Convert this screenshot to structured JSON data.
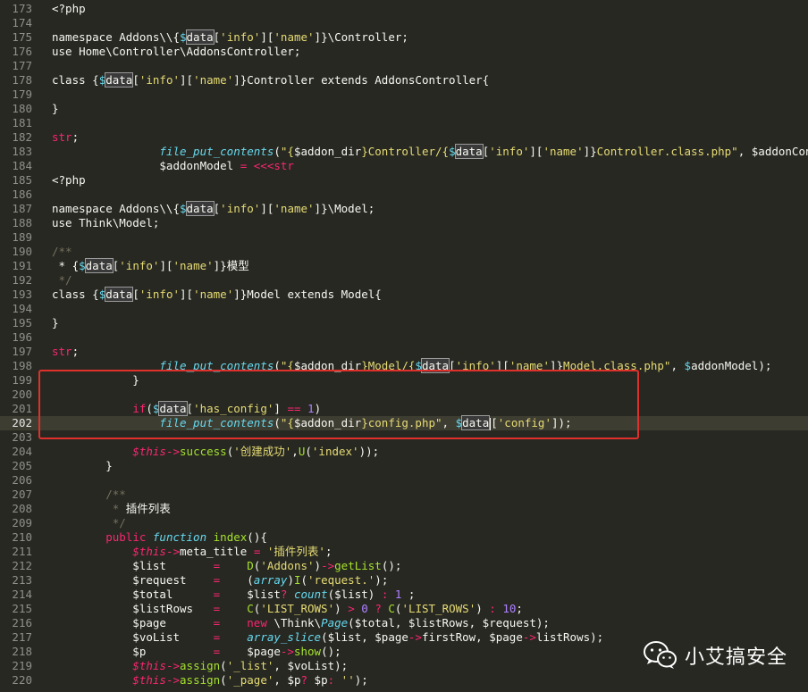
{
  "lines": [
    {
      "n": "173",
      "tokens": [
        {
          "c": "t-p",
          "t": "<?php"
        }
      ]
    },
    {
      "n": "174",
      "tokens": []
    },
    {
      "n": "175",
      "tokens": [
        {
          "c": "t-p",
          "t": "namespace Addons\\\\{"
        },
        {
          "c": "t-v",
          "t": "$"
        },
        {
          "c": "t-p",
          "t": "data",
          "box": true
        },
        {
          "c": "t-p",
          "t": "["
        },
        {
          "c": "t-s",
          "t": "'info'"
        },
        {
          "c": "t-p",
          "t": "]["
        },
        {
          "c": "t-s",
          "t": "'name'"
        },
        {
          "c": "t-p",
          "t": "]}\\Controller;"
        }
      ]
    },
    {
      "n": "176",
      "tokens": [
        {
          "c": "t-p",
          "t": "use Home\\Controller\\AddonsController;"
        }
      ]
    },
    {
      "n": "177",
      "tokens": []
    },
    {
      "n": "178",
      "tokens": [
        {
          "c": "t-p",
          "t": "class {"
        },
        {
          "c": "t-v",
          "t": "$"
        },
        {
          "c": "t-p",
          "t": "data",
          "box": true
        },
        {
          "c": "t-p",
          "t": "["
        },
        {
          "c": "t-s",
          "t": "'info'"
        },
        {
          "c": "t-p",
          "t": "]["
        },
        {
          "c": "t-s",
          "t": "'name'"
        },
        {
          "c": "t-p",
          "t": "]}Controller extends AddonsController{"
        }
      ]
    },
    {
      "n": "179",
      "tokens": []
    },
    {
      "n": "180",
      "tokens": [
        {
          "c": "t-p",
          "t": "}"
        }
      ]
    },
    {
      "n": "181",
      "tokens": []
    },
    {
      "n": "182",
      "tokens": [
        {
          "c": "t-k",
          "t": "str"
        },
        {
          "c": "t-p",
          "t": ";"
        }
      ]
    },
    {
      "n": "183",
      "tokens": [
        {
          "c": "t-p",
          "t": "                "
        },
        {
          "c": "t-fi",
          "t": "file_put_contents"
        },
        {
          "c": "t-p",
          "t": "("
        },
        {
          "c": "t-s",
          "t": "\"{"
        },
        {
          "c": "t-p",
          "t": "$addon_dir"
        },
        {
          "c": "t-s",
          "t": "}Controller/{"
        },
        {
          "c": "t-v",
          "t": "$"
        },
        {
          "c": "t-p",
          "t": "data",
          "box": true
        },
        {
          "c": "t-p",
          "t": "["
        },
        {
          "c": "t-s",
          "t": "'info'"
        },
        {
          "c": "t-p",
          "t": "]["
        },
        {
          "c": "t-s",
          "t": "'name'"
        },
        {
          "c": "t-p",
          "t": "]}"
        },
        {
          "c": "t-s",
          "t": "Controller.class.php\""
        },
        {
          "c": "t-p",
          "t": ", $addonControl"
        }
      ]
    },
    {
      "n": "184",
      "tokens": [
        {
          "c": "t-p",
          "t": "                $addonModel "
        },
        {
          "c": "t-k",
          "t": "="
        },
        {
          "c": "t-p",
          "t": " "
        },
        {
          "c": "t-k",
          "t": "<<<str"
        }
      ]
    },
    {
      "n": "185",
      "tokens": [
        {
          "c": "t-p",
          "t": "<?php"
        }
      ]
    },
    {
      "n": "186",
      "tokens": []
    },
    {
      "n": "187",
      "tokens": [
        {
          "c": "t-p",
          "t": "namespace Addons\\\\{"
        },
        {
          "c": "t-v",
          "t": "$"
        },
        {
          "c": "t-p",
          "t": "data",
          "box": true
        },
        {
          "c": "t-p",
          "t": "["
        },
        {
          "c": "t-s",
          "t": "'info'"
        },
        {
          "c": "t-p",
          "t": "]["
        },
        {
          "c": "t-s",
          "t": "'name'"
        },
        {
          "c": "t-p",
          "t": "]}\\Model;"
        }
      ]
    },
    {
      "n": "188",
      "tokens": [
        {
          "c": "t-p",
          "t": "use Think\\Model;"
        }
      ]
    },
    {
      "n": "189",
      "tokens": []
    },
    {
      "n": "190",
      "tokens": [
        {
          "c": "t-c",
          "t": "/**"
        }
      ]
    },
    {
      "n": "191",
      "tokens": [
        {
          "c": "t-p",
          "t": " * {"
        },
        {
          "c": "t-v",
          "t": "$"
        },
        {
          "c": "t-p",
          "t": "data",
          "box": true
        },
        {
          "c": "t-p",
          "t": "["
        },
        {
          "c": "t-s",
          "t": "'info'"
        },
        {
          "c": "t-p",
          "t": "]["
        },
        {
          "c": "t-s",
          "t": "'name'"
        },
        {
          "c": "t-p",
          "t": "]}模型"
        }
      ]
    },
    {
      "n": "192",
      "tokens": [
        {
          "c": "t-c",
          "t": " */"
        }
      ]
    },
    {
      "n": "193",
      "tokens": [
        {
          "c": "t-p",
          "t": "class {"
        },
        {
          "c": "t-v",
          "t": "$"
        },
        {
          "c": "t-p",
          "t": "data",
          "box": true
        },
        {
          "c": "t-p",
          "t": "["
        },
        {
          "c": "t-s",
          "t": "'info'"
        },
        {
          "c": "t-p",
          "t": "]["
        },
        {
          "c": "t-s",
          "t": "'name'"
        },
        {
          "c": "t-p",
          "t": "]}Model extends Model{"
        }
      ]
    },
    {
      "n": "194",
      "tokens": []
    },
    {
      "n": "195",
      "tokens": [
        {
          "c": "t-p",
          "t": "}"
        }
      ]
    },
    {
      "n": "196",
      "tokens": []
    },
    {
      "n": "197",
      "tokens": [
        {
          "c": "t-k",
          "t": "str"
        },
        {
          "c": "t-p",
          "t": ";"
        }
      ]
    },
    {
      "n": "198",
      "tokens": [
        {
          "c": "t-p",
          "t": "                "
        },
        {
          "c": "t-fi",
          "t": "file_put_contents"
        },
        {
          "c": "t-p",
          "t": "("
        },
        {
          "c": "t-s",
          "t": "\"{"
        },
        {
          "c": "t-p",
          "t": "$addon_dir"
        },
        {
          "c": "t-s",
          "t": "}Model/{"
        },
        {
          "c": "t-v",
          "t": "$"
        },
        {
          "c": "t-p",
          "t": "data",
          "box": true
        },
        {
          "c": "t-p",
          "t": "["
        },
        {
          "c": "t-s",
          "t": "'info'"
        },
        {
          "c": "t-p",
          "t": "]["
        },
        {
          "c": "t-s",
          "t": "'name'"
        },
        {
          "c": "t-p",
          "t": "]}"
        },
        {
          "c": "t-s",
          "t": "Model.class.php\""
        },
        {
          "c": "t-p",
          "t": ", "
        },
        {
          "c": "t-v",
          "t": "$"
        },
        {
          "c": "t-p",
          "t": "addonModel);"
        }
      ]
    },
    {
      "n": "199",
      "tokens": [
        {
          "c": "t-p",
          "t": "            }"
        }
      ]
    },
    {
      "n": "200",
      "tokens": []
    },
    {
      "n": "201",
      "tokens": [
        {
          "c": "t-p",
          "t": "            "
        },
        {
          "c": "t-k",
          "t": "if"
        },
        {
          "c": "t-p",
          "t": "("
        },
        {
          "c": "t-v",
          "t": "$"
        },
        {
          "c": "t-p",
          "t": "data",
          "box": true
        },
        {
          "c": "t-p",
          "t": "["
        },
        {
          "c": "t-s",
          "t": "'has_config'"
        },
        {
          "c": "t-p",
          "t": "] "
        },
        {
          "c": "t-k",
          "t": "=="
        },
        {
          "c": "t-p",
          "t": " "
        },
        {
          "c": "t-n",
          "t": "1"
        },
        {
          "c": "t-p",
          "t": ")"
        }
      ]
    },
    {
      "n": "202",
      "current": true,
      "tokens": [
        {
          "c": "t-p",
          "t": "                "
        },
        {
          "c": "t-fi",
          "t": "file_put_contents"
        },
        {
          "c": "t-p",
          "t": "("
        },
        {
          "c": "t-s",
          "t": "\"{"
        },
        {
          "c": "t-p",
          "t": "$addon_dir"
        },
        {
          "c": "t-s",
          "t": "}config.php\""
        },
        {
          "c": "t-p",
          "t": ", "
        },
        {
          "c": "t-v",
          "t": "$"
        },
        {
          "c": "t-p",
          "t": "data",
          "box": true,
          "cursor": true
        },
        {
          "c": "t-p",
          "t": "["
        },
        {
          "c": "t-s",
          "t": "'config'"
        },
        {
          "c": "t-p",
          "t": "]);"
        }
      ]
    },
    {
      "n": "203",
      "tokens": []
    },
    {
      "n": "204",
      "tokens": [
        {
          "c": "t-p",
          "t": "            "
        },
        {
          "c": "t-ti",
          "t": "$this"
        },
        {
          "c": "t-k",
          "t": "->"
        },
        {
          "c": "t-f",
          "t": "success"
        },
        {
          "c": "t-p",
          "t": "("
        },
        {
          "c": "t-s",
          "t": "'创建成功'"
        },
        {
          "c": "t-p",
          "t": ","
        },
        {
          "c": "t-f",
          "t": "U"
        },
        {
          "c": "t-p",
          "t": "("
        },
        {
          "c": "t-s",
          "t": "'index'"
        },
        {
          "c": "t-p",
          "t": "));"
        }
      ]
    },
    {
      "n": "205",
      "tokens": [
        {
          "c": "t-p",
          "t": "        }"
        }
      ]
    },
    {
      "n": "206",
      "tokens": []
    },
    {
      "n": "207",
      "tokens": [
        {
          "c": "t-c",
          "t": "        /**"
        }
      ]
    },
    {
      "n": "208",
      "tokens": [
        {
          "c": "t-c",
          "t": "         * "
        },
        {
          "c": "t-p",
          "t": "插件列表"
        }
      ]
    },
    {
      "n": "209",
      "tokens": [
        {
          "c": "t-c",
          "t": "         */"
        }
      ]
    },
    {
      "n": "210",
      "tokens": [
        {
          "c": "t-p",
          "t": "        "
        },
        {
          "c": "t-k",
          "t": "public"
        },
        {
          "c": "t-p",
          "t": " "
        },
        {
          "c": "t-fi",
          "t": "function"
        },
        {
          "c": "t-p",
          "t": " "
        },
        {
          "c": "t-f",
          "t": "index"
        },
        {
          "c": "t-p",
          "t": "(){"
        }
      ]
    },
    {
      "n": "211",
      "tokens": [
        {
          "c": "t-p",
          "t": "            "
        },
        {
          "c": "t-ti",
          "t": "$this"
        },
        {
          "c": "t-k",
          "t": "->"
        },
        {
          "c": "t-p",
          "t": "meta_title "
        },
        {
          "c": "t-k",
          "t": "="
        },
        {
          "c": "t-p",
          "t": " "
        },
        {
          "c": "t-s",
          "t": "'插件列表'"
        },
        {
          "c": "t-p",
          "t": ";"
        }
      ]
    },
    {
      "n": "212",
      "tokens": [
        {
          "c": "t-p",
          "t": "            $list       "
        },
        {
          "c": "t-k",
          "t": "="
        },
        {
          "c": "t-p",
          "t": "    "
        },
        {
          "c": "t-f",
          "t": "D"
        },
        {
          "c": "t-p",
          "t": "("
        },
        {
          "c": "t-s",
          "t": "'Addons'"
        },
        {
          "c": "t-p",
          "t": ")"
        },
        {
          "c": "t-k",
          "t": "->"
        },
        {
          "c": "t-f",
          "t": "getList"
        },
        {
          "c": "t-p",
          "t": "();"
        }
      ]
    },
    {
      "n": "213",
      "tokens": [
        {
          "c": "t-p",
          "t": "            $request    "
        },
        {
          "c": "t-k",
          "t": "="
        },
        {
          "c": "t-p",
          "t": "    ("
        },
        {
          "c": "t-fi",
          "t": "array"
        },
        {
          "c": "t-p",
          "t": ")"
        },
        {
          "c": "t-f",
          "t": "I"
        },
        {
          "c": "t-p",
          "t": "("
        },
        {
          "c": "t-s",
          "t": "'request.'"
        },
        {
          "c": "t-p",
          "t": ");"
        }
      ]
    },
    {
      "n": "214",
      "tokens": [
        {
          "c": "t-p",
          "t": "            $total      "
        },
        {
          "c": "t-k",
          "t": "="
        },
        {
          "c": "t-p",
          "t": "    $list"
        },
        {
          "c": "t-k",
          "t": "?"
        },
        {
          "c": "t-p",
          "t": " "
        },
        {
          "c": "t-fi",
          "t": "count"
        },
        {
          "c": "t-p",
          "t": "($list) "
        },
        {
          "c": "t-k",
          "t": ":"
        },
        {
          "c": "t-p",
          "t": " "
        },
        {
          "c": "t-n",
          "t": "1"
        },
        {
          "c": "t-p",
          "t": " ;"
        }
      ]
    },
    {
      "n": "215",
      "tokens": [
        {
          "c": "t-p",
          "t": "            $listRows   "
        },
        {
          "c": "t-k",
          "t": "="
        },
        {
          "c": "t-p",
          "t": "    "
        },
        {
          "c": "t-f",
          "t": "C"
        },
        {
          "c": "t-p",
          "t": "("
        },
        {
          "c": "t-s",
          "t": "'LIST_ROWS'"
        },
        {
          "c": "t-p",
          "t": ") "
        },
        {
          "c": "t-k",
          "t": ">"
        },
        {
          "c": "t-p",
          "t": " "
        },
        {
          "c": "t-n",
          "t": "0"
        },
        {
          "c": "t-p",
          "t": " "
        },
        {
          "c": "t-k",
          "t": "?"
        },
        {
          "c": "t-p",
          "t": " "
        },
        {
          "c": "t-f",
          "t": "C"
        },
        {
          "c": "t-p",
          "t": "("
        },
        {
          "c": "t-s",
          "t": "'LIST_ROWS'"
        },
        {
          "c": "t-p",
          "t": ") "
        },
        {
          "c": "t-k",
          "t": ":"
        },
        {
          "c": "t-p",
          "t": " "
        },
        {
          "c": "t-n",
          "t": "10"
        },
        {
          "c": "t-p",
          "t": ";"
        }
      ]
    },
    {
      "n": "216",
      "tokens": [
        {
          "c": "t-p",
          "t": "            $page       "
        },
        {
          "c": "t-k",
          "t": "="
        },
        {
          "c": "t-p",
          "t": "    "
        },
        {
          "c": "t-k",
          "t": "new"
        },
        {
          "c": "t-p",
          "t": " \\Think\\"
        },
        {
          "c": "t-fi",
          "t": "Page"
        },
        {
          "c": "t-p",
          "t": "($total, $listRows, $request);"
        }
      ]
    },
    {
      "n": "217",
      "tokens": [
        {
          "c": "t-p",
          "t": "            $voList     "
        },
        {
          "c": "t-k",
          "t": "="
        },
        {
          "c": "t-p",
          "t": "    "
        },
        {
          "c": "t-fi",
          "t": "array_slice"
        },
        {
          "c": "t-p",
          "t": "($list, $page"
        },
        {
          "c": "t-k",
          "t": "->"
        },
        {
          "c": "t-p",
          "t": "firstRow, $page"
        },
        {
          "c": "t-k",
          "t": "->"
        },
        {
          "c": "t-p",
          "t": "listRows);"
        }
      ]
    },
    {
      "n": "218",
      "tokens": [
        {
          "c": "t-p",
          "t": "            $p          "
        },
        {
          "c": "t-k",
          "t": "="
        },
        {
          "c": "t-p",
          "t": "    $page"
        },
        {
          "c": "t-k",
          "t": "->"
        },
        {
          "c": "t-f",
          "t": "show"
        },
        {
          "c": "t-p",
          "t": "();"
        }
      ]
    },
    {
      "n": "219",
      "tokens": [
        {
          "c": "t-p",
          "t": "            "
        },
        {
          "c": "t-ti",
          "t": "$this"
        },
        {
          "c": "t-k",
          "t": "->"
        },
        {
          "c": "t-f",
          "t": "assign"
        },
        {
          "c": "t-p",
          "t": "("
        },
        {
          "c": "t-s",
          "t": "'_list'"
        },
        {
          "c": "t-p",
          "t": ", $voList);"
        }
      ]
    },
    {
      "n": "220",
      "tokens": [
        {
          "c": "t-p",
          "t": "            "
        },
        {
          "c": "t-ti",
          "t": "$this"
        },
        {
          "c": "t-k",
          "t": "->"
        },
        {
          "c": "t-f",
          "t": "assign"
        },
        {
          "c": "t-p",
          "t": "("
        },
        {
          "c": "t-s",
          "t": "'_page'"
        },
        {
          "c": "t-p",
          "t": ", $p"
        },
        {
          "c": "t-k",
          "t": "?"
        },
        {
          "c": "t-p",
          "t": " $p"
        },
        {
          "c": "t-k",
          "t": ":"
        },
        {
          "c": "t-p",
          "t": " "
        },
        {
          "c": "t-s",
          "t": "''"
        },
        {
          "c": "t-p",
          "t": ");"
        }
      ]
    }
  ],
  "watermark": {
    "text": "小艾搞安全",
    "icon": "wechat-icon"
  },
  "colors": {
    "background": "#272822",
    "highlight_border": "#e0302b"
  }
}
